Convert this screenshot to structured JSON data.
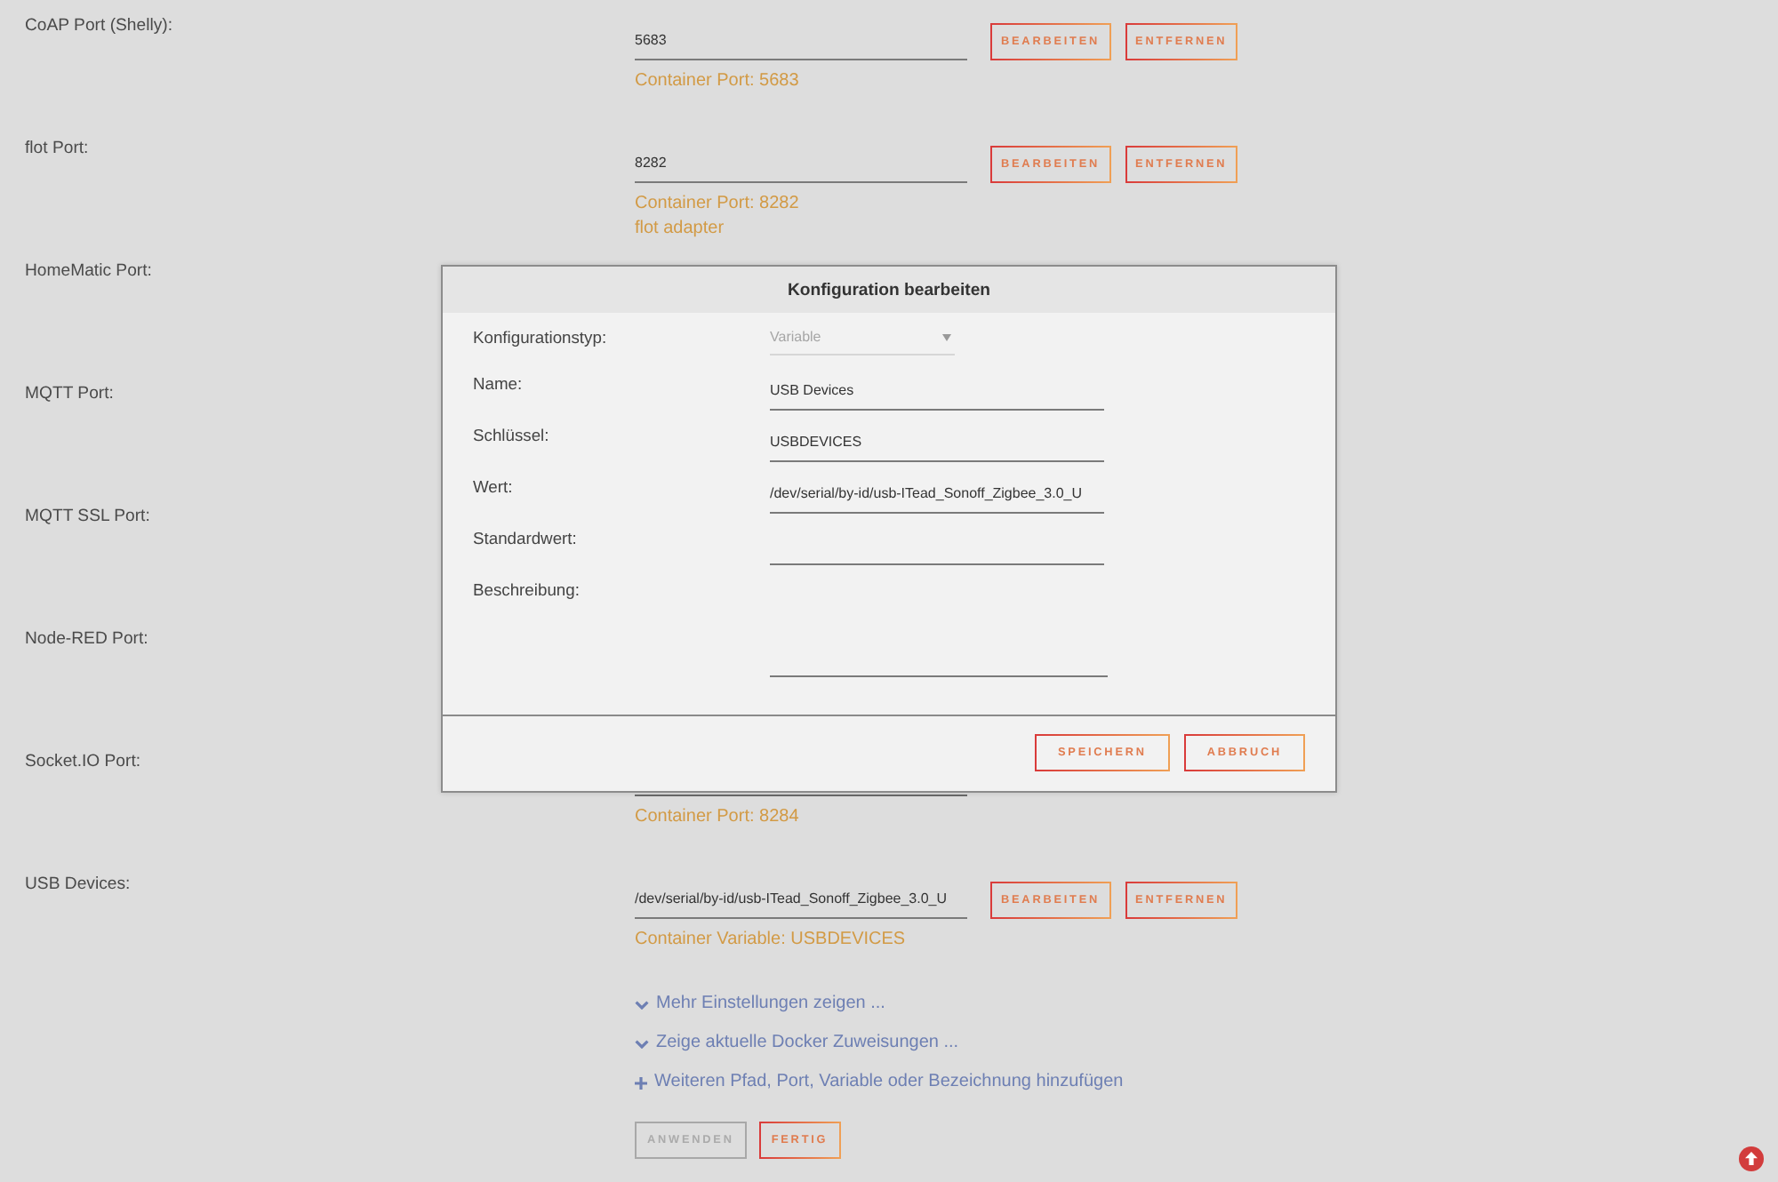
{
  "settings": [
    {
      "label": "CoAP Port (Shelly):",
      "value": "5683",
      "notes": [
        "Container Port: 5683"
      ],
      "buttons": [
        "BEARBEITEN",
        "ENTFERNEN"
      ]
    },
    {
      "label": "flot Port:",
      "value": "8282",
      "notes": [
        "Container Port: 8282",
        "flot adapter"
      ],
      "buttons": [
        "BEARBEITEN",
        "ENTFERNEN"
      ]
    },
    {
      "label": "HomeMatic Port:"
    },
    {
      "label": "MQTT Port:"
    },
    {
      "label": "MQTT SSL Port:"
    },
    {
      "label": "Node-RED Port:"
    },
    {
      "label": "Socket.IO Port:",
      "notes": [
        "Container Port: 8284"
      ]
    },
    {
      "label": "USB Devices:",
      "value": "/dev/serial/by-id/usb-ITead_Sonoff_Zigbee_3.0_U",
      "notes": [
        "Container Variable: USBDEVICES"
      ],
      "buttons": [
        "BEARBEITEN",
        "ENTFERNEN"
      ]
    }
  ],
  "links": [
    {
      "kind": "expand",
      "label": "Mehr Einstellungen zeigen ..."
    },
    {
      "kind": "expand",
      "label": "Zeige aktuelle Docker Zuweisungen ..."
    },
    {
      "kind": "add",
      "label": "Weiteren Pfad, Port, Variable oder Bezeichnung hinzufügen"
    }
  ],
  "actions": [
    {
      "label": "ANWENDEN",
      "disabled": true
    },
    {
      "label": "FERTIG",
      "disabled": false
    }
  ],
  "dialog": {
    "title": "Konfiguration bearbeiten",
    "fields": [
      {
        "kind": "select",
        "label": "Konfigurationstyp:",
        "value": "Variable",
        "disabled": true
      },
      {
        "kind": "text",
        "label": "Name:",
        "value": "USB Devices",
        "disabled": false
      },
      {
        "kind": "text",
        "label": "Schlüssel:",
        "value": "USBDEVICES",
        "disabled": false
      },
      {
        "kind": "text",
        "label": "Wert:",
        "value": "/dev/serial/by-id/usb-ITead_Sonoff_Zigbee_3.0_U",
        "disabled": false
      },
      {
        "kind": "text",
        "label": "Standardwert:",
        "disabled": false
      },
      {
        "kind": "textarea",
        "label": "Beschreibung:",
        "disabled": false
      }
    ],
    "buttons": [
      "SPEICHERN",
      "ABBRUCH"
    ]
  }
}
